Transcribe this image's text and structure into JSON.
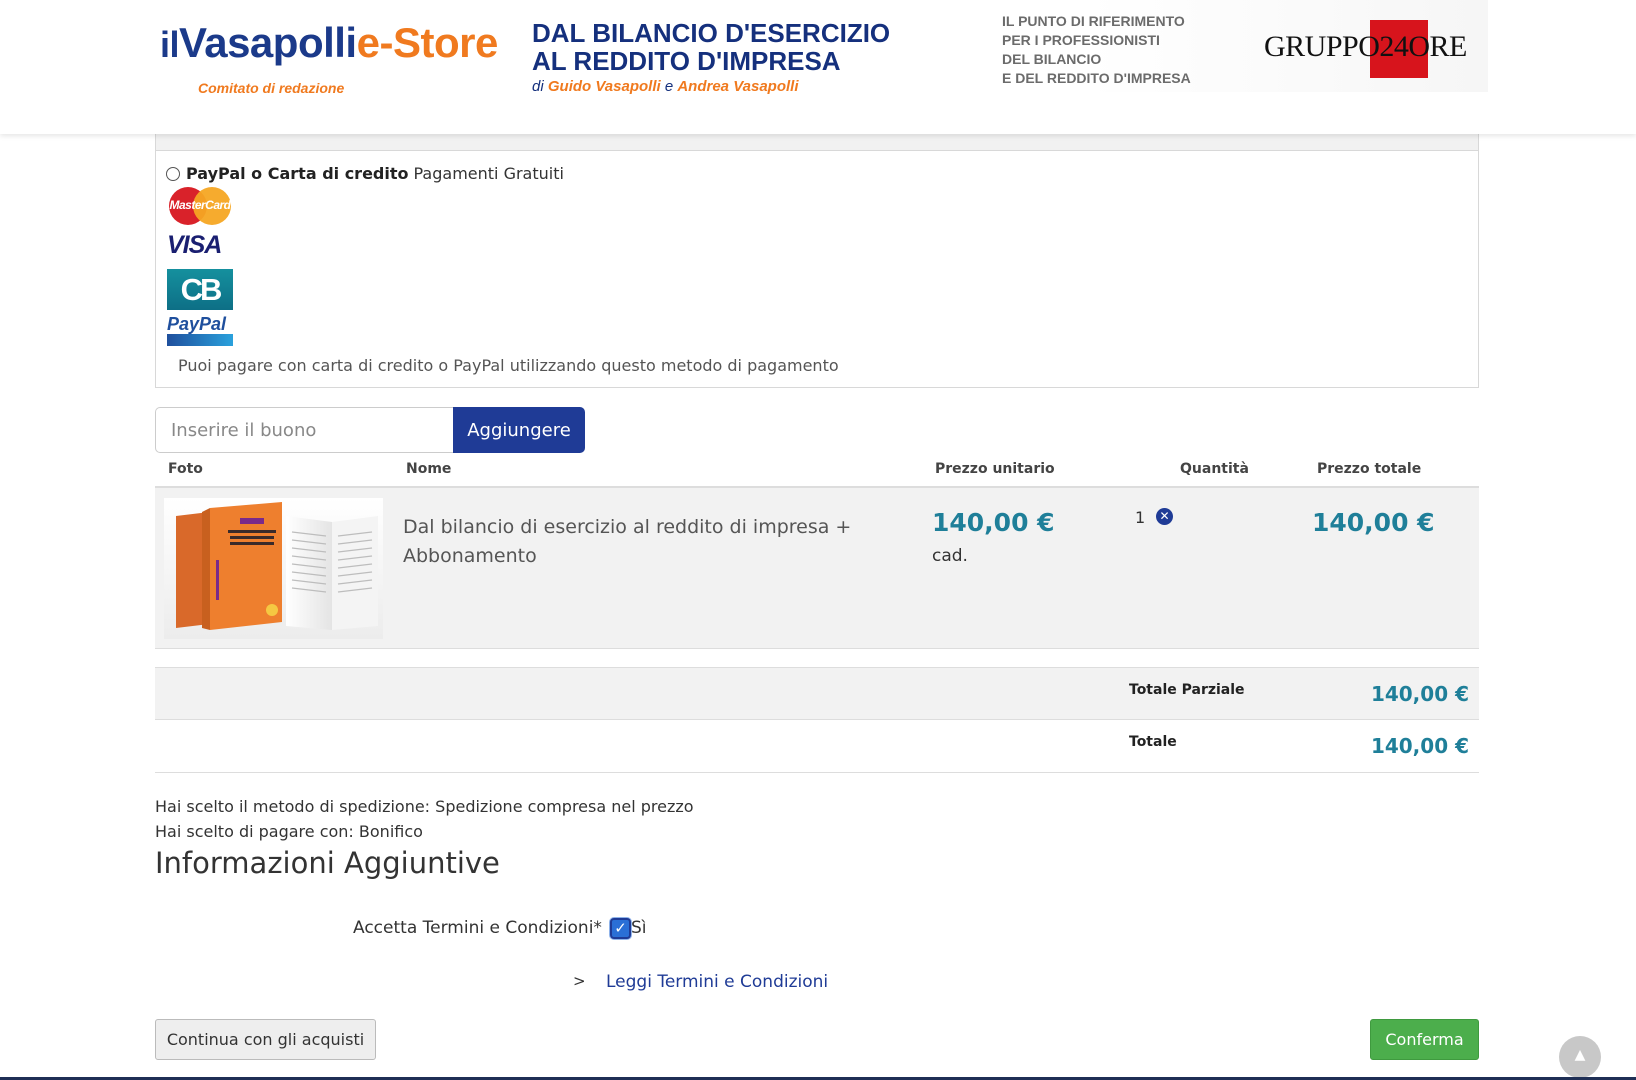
{
  "header": {
    "logo": {
      "prefix": "il",
      "name": "Vasapolli",
      "suffix": "e-Store",
      "subtitle": "Comitato di redazione"
    },
    "headline": {
      "line1": "DAL BILANCIO D'ESERCIZIO",
      "line2": "AL REDDITO D'IMPRESA"
    },
    "authors": {
      "di": "di",
      "author1": "Guido Vasapolli",
      "e": "e",
      "author2": "Andrea Vasapolli"
    },
    "tagline": [
      "IL PUNTO DI RIFERIMENTO",
      "PER I PROFESSIONISTI",
      "DEL BILANCIO",
      "E DEL REDDITO D'IMPRESA"
    ],
    "publisher": "GRUPPO24ORE",
    "colors": {
      "brand_blue": "#1b3a8a",
      "brand_orange": "#f07a1f",
      "publisher_red": "#d7141c"
    }
  },
  "payment": {
    "option_title": "PayPal o Carta di credito",
    "option_note": "Pagamenti Gratuiti",
    "cards": [
      "MasterCard",
      "VISA",
      "CB",
      "PayPal"
    ],
    "description": "Puoi pagare con carta di credito o PayPal utilizzando questo metodo di pagamento",
    "selected": false
  },
  "coupon": {
    "placeholder": "Inserire il buono",
    "button": "Aggiungere"
  },
  "cart": {
    "columns": {
      "photo": "Foto",
      "name": "Nome",
      "unit_price": "Prezzo unitario",
      "quantity": "Quantità",
      "total_price": "Prezzo totale"
    },
    "items": [
      {
        "name": "Dal bilancio di esercizio al reddito di impresa + Abbonamento",
        "unit_price": "140,00 €",
        "unit_suffix": "cad.",
        "quantity": "1",
        "total_price": "140,00 €",
        "remove_icon": "times-circle-icon"
      }
    ]
  },
  "totals": {
    "subtotal_label": "Totale Parziale",
    "subtotal_value": "140,00 €",
    "total_label": "Totale",
    "total_value": "140,00 €"
  },
  "summary": {
    "shipping": "Hai scelto il metodo di spedizione: Spedizione compresa nel prezzo",
    "payment": "Hai scelto di pagare con: Bonifico"
  },
  "additional_info": {
    "title": "Informazioni Aggiuntive",
    "terms_label": "Accetta Termini e Condizioni*",
    "terms_checked": true,
    "terms_yes": "Sì",
    "read_terms_prefix": ">",
    "read_terms_link": "Leggi Termini e Condizioni"
  },
  "actions": {
    "continue": "Continua con gli acquisti",
    "confirm": "Conferma"
  },
  "scroll_top_icon": "chevron-up-icon"
}
